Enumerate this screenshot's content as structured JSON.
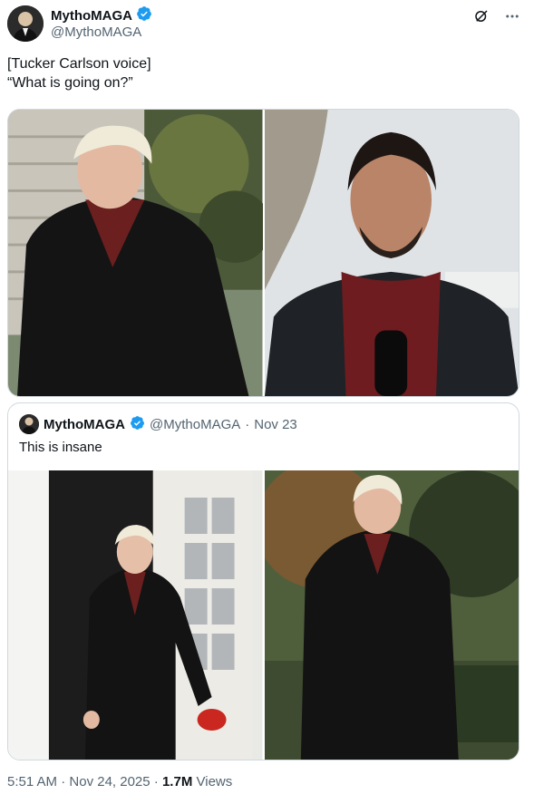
{
  "tweet": {
    "display_name": "MythoMAGA",
    "handle": "@MythoMAGA",
    "text": "[Tucker Carlson voice]\n“What is going on?”",
    "verified_icon": "verified-badge-icon",
    "colors": {
      "verified": "#1d9bf0",
      "secondary_text": "#536471",
      "primary_text": "#0f1419",
      "border": "#cfd9de"
    }
  },
  "actions": {
    "grok_icon": "grok-icon",
    "more_icon": "more-options-icon"
  },
  "quote": {
    "display_name": "MythoMAGA",
    "handle": "@MythoMAGA",
    "separator": "·",
    "date": "Nov 23",
    "text": "This is insane"
  },
  "footer": {
    "time": "5:51 AM",
    "separator1": "·",
    "date": "Nov 24, 2025",
    "separator2": "·",
    "views_count": "1.7M",
    "views_label": "Views"
  }
}
